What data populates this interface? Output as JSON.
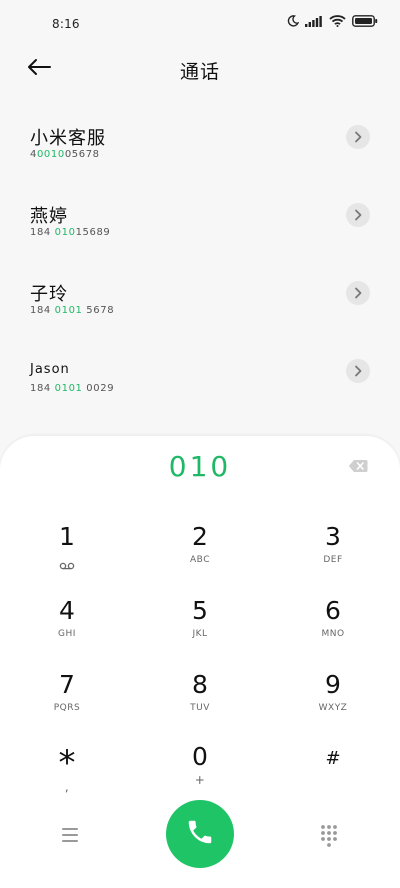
{
  "status_bar": {
    "time": "8:16"
  },
  "header": {
    "title": "通话"
  },
  "contacts": [
    {
      "name": "小米客服",
      "number_parts": [
        "4",
        "0010",
        "05678"
      ]
    },
    {
      "name": "燕婷",
      "number_parts": [
        "184 ",
        "010",
        "15689"
      ]
    },
    {
      "name": "子玲",
      "number_parts": [
        "184 ",
        "0101",
        " 5678"
      ]
    },
    {
      "name": "Jason",
      "number_parts": [
        "184 ",
        "0101",
        " 0029"
      ]
    }
  ],
  "dialer": {
    "input": "010",
    "keys": [
      {
        "digit": "1",
        "letters": ""
      },
      {
        "digit": "2",
        "letters": "ABC"
      },
      {
        "digit": "3",
        "letters": "DEF"
      },
      {
        "digit": "4",
        "letters": "GHI"
      },
      {
        "digit": "5",
        "letters": "JKL"
      },
      {
        "digit": "6",
        "letters": "MNO"
      },
      {
        "digit": "7",
        "letters": "PQRS"
      },
      {
        "digit": "8",
        "letters": "TUV"
      },
      {
        "digit": "9",
        "letters": "WXYZ"
      },
      {
        "digit": "*",
        "letters": ","
      },
      {
        "digit": "0",
        "letters": "+"
      },
      {
        "digit": "#",
        "letters": ""
      }
    ]
  },
  "colors": {
    "accent": "#1fb867",
    "call_button": "#1fc466",
    "background": "#f7f7f7",
    "panel": "#ffffff"
  },
  "icons": {
    "back": "arrow-left-icon",
    "info": "chevron-right-icon",
    "backspace": "backspace-icon",
    "voicemail": "voicemail-icon",
    "menu": "menu-icon",
    "call": "phone-icon",
    "keypad": "dialpad-icon"
  }
}
